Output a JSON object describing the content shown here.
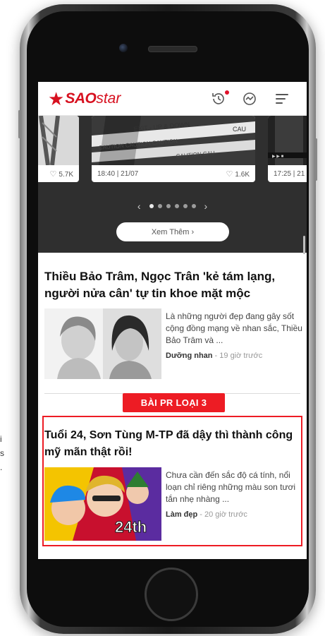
{
  "stray": {
    "line1": "i",
    "line2": "s",
    "line3": "."
  },
  "header": {
    "logo_sao": "SAO",
    "logo_star": "star",
    "history_icon": "history-icon",
    "trending_icon": "trending-icon",
    "menu_icon": "menu-icon"
  },
  "video_carousel": {
    "left_card": {
      "likes": "5.7K"
    },
    "center_card": {
      "timestamp": "18:40 | 21/07",
      "likes": "1.6K"
    },
    "right_card": {
      "timestamp": "17:25 | 21"
    },
    "pager": {
      "prev": "‹",
      "next": "›",
      "dot_count": 6,
      "active_index": 0
    },
    "see_more": "Xem Thêm  ›"
  },
  "article1": {
    "title": "Thiều Bảo Trâm, Ngọc Trân 'kẻ tám lạng, người nửa cân' tự tin khoe mặt mộc",
    "excerpt": "Là những người đẹp đang gây sốt cộng đồng mạng về nhan sắc, Thiều Bảo Trâm và ...",
    "category": "Dưỡng nhan",
    "time": " - 19 giờ trước"
  },
  "pr_label": "BÀI PR LOẠI 3",
  "article2": {
    "title": "Tuổi 24, Sơn Tùng M-TP đã dậy thì thành công mỹ mãn thật rồi!",
    "excerpt": "Chưa cần đến sắc độ cá tính, nổi loạn chỉ riêng những màu son tươi tắn nhẹ nhàng ...",
    "category": "Làm đẹp",
    "time": " - 20 giờ trước",
    "thumb_text": "24th"
  },
  "colors": {
    "brand_red": "#d7101f",
    "pr_red": "#ed1c24",
    "dark_band": "#2f2f2f"
  }
}
